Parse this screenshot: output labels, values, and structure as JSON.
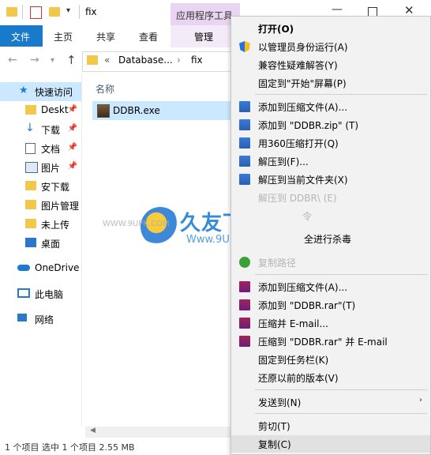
{
  "window": {
    "title": "fix"
  },
  "ribbon": {
    "file_tab": "文件",
    "tabs": [
      "主页",
      "共享",
      "查看"
    ],
    "context_group": "应用程序工具",
    "manage_tab": "管理"
  },
  "address": {
    "overflow": "«",
    "path": [
      "Database...",
      "fix"
    ]
  },
  "sidebar": {
    "items": [
      {
        "label": "快速访问"
      },
      {
        "label": "Deskt"
      },
      {
        "label": "下载"
      },
      {
        "label": "文档"
      },
      {
        "label": "图片"
      },
      {
        "label": "安下载"
      },
      {
        "label": "图片管理"
      },
      {
        "label": "未上传"
      },
      {
        "label": "桌面"
      },
      {
        "label": "OneDrive"
      },
      {
        "label": "此电脑"
      },
      {
        "label": "网络"
      }
    ]
  },
  "content": {
    "column_name": "名称",
    "files": [
      {
        "name": "DDBR.exe"
      }
    ]
  },
  "status": {
    "text": "1 个项目    选中 1 个项目  2.55 MB"
  },
  "context_menu": {
    "items": [
      {
        "label": "打开(O)"
      },
      {
        "label": "以管理员身份运行(A)"
      },
      {
        "label": "兼容性疑难解答(Y)"
      },
      {
        "label": "固定到\"开始\"屏幕(P)"
      },
      {
        "label": "添加到压缩文件(A)..."
      },
      {
        "label": "添加到 \"DDBR.zip\" (T)"
      },
      {
        "label": "用360压缩打开(Q)"
      },
      {
        "label": "解压到(F)..."
      },
      {
        "label": "解压到当前文件夹(X)"
      },
      {
        "label": "解压到 DDBR\\ (E)"
      },
      {
        "label": "令"
      },
      {
        "label": "全进行杀毒"
      },
      {
        "label": "复制路径"
      },
      {
        "label": "添加到压缩文件(A)..."
      },
      {
        "label": "添加到 \"DDBR.rar\"(T)"
      },
      {
        "label": "压缩并 E-mail..."
      },
      {
        "label": "压缩到 \"DDBR.rar\" 并 E-mail"
      },
      {
        "label": "固定到任务栏(K)"
      },
      {
        "label": "还原以前的版本(V)"
      },
      {
        "label": "发送到(N)"
      },
      {
        "label": "剪切(T)"
      },
      {
        "label": "复制(C)"
      }
    ]
  },
  "watermark": {
    "title": "久友下载站",
    "url": "Www.9UPK.Com",
    "url_small": "WWW.9UPK.COM"
  }
}
